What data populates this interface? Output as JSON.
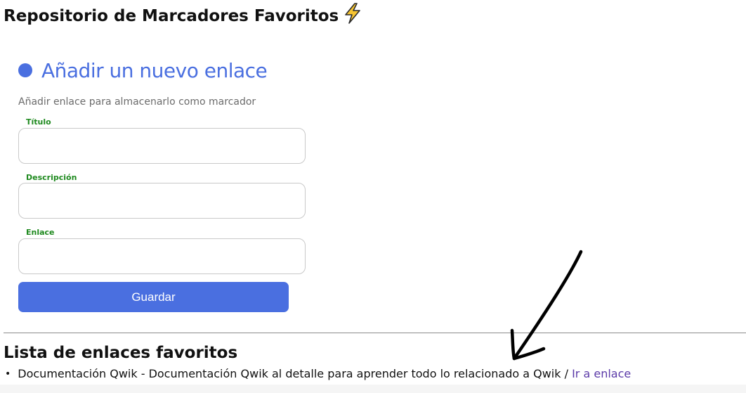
{
  "header": {
    "title": "Repositorio de Marcadores Favoritos",
    "title_icon": "lightning-bolt-icon"
  },
  "form": {
    "heading": "Añadir un nuevo enlace",
    "subtitle": "Añadir enlace para almacenarlo como marcador",
    "accent_color": "#4a6fe0",
    "label_color": "#1f8a1f",
    "fields": [
      {
        "label": "Título",
        "value": ""
      },
      {
        "label": "Descripción",
        "value": ""
      },
      {
        "label": "Enlace",
        "value": ""
      }
    ],
    "submit_label": "Guardar"
  },
  "favorites": {
    "heading": "Lista de enlaces favoritos",
    "items": [
      {
        "title": "Documentación Qwik",
        "separator": " - ",
        "description": "Documentación Qwik al detalle para aprender todo lo relacionado a Qwik",
        "link_separator": " / ",
        "link_label": "Ir a enlace"
      }
    ]
  },
  "annotation": {
    "icon": "hand-drawn-arrow-icon",
    "color": "#000000"
  }
}
